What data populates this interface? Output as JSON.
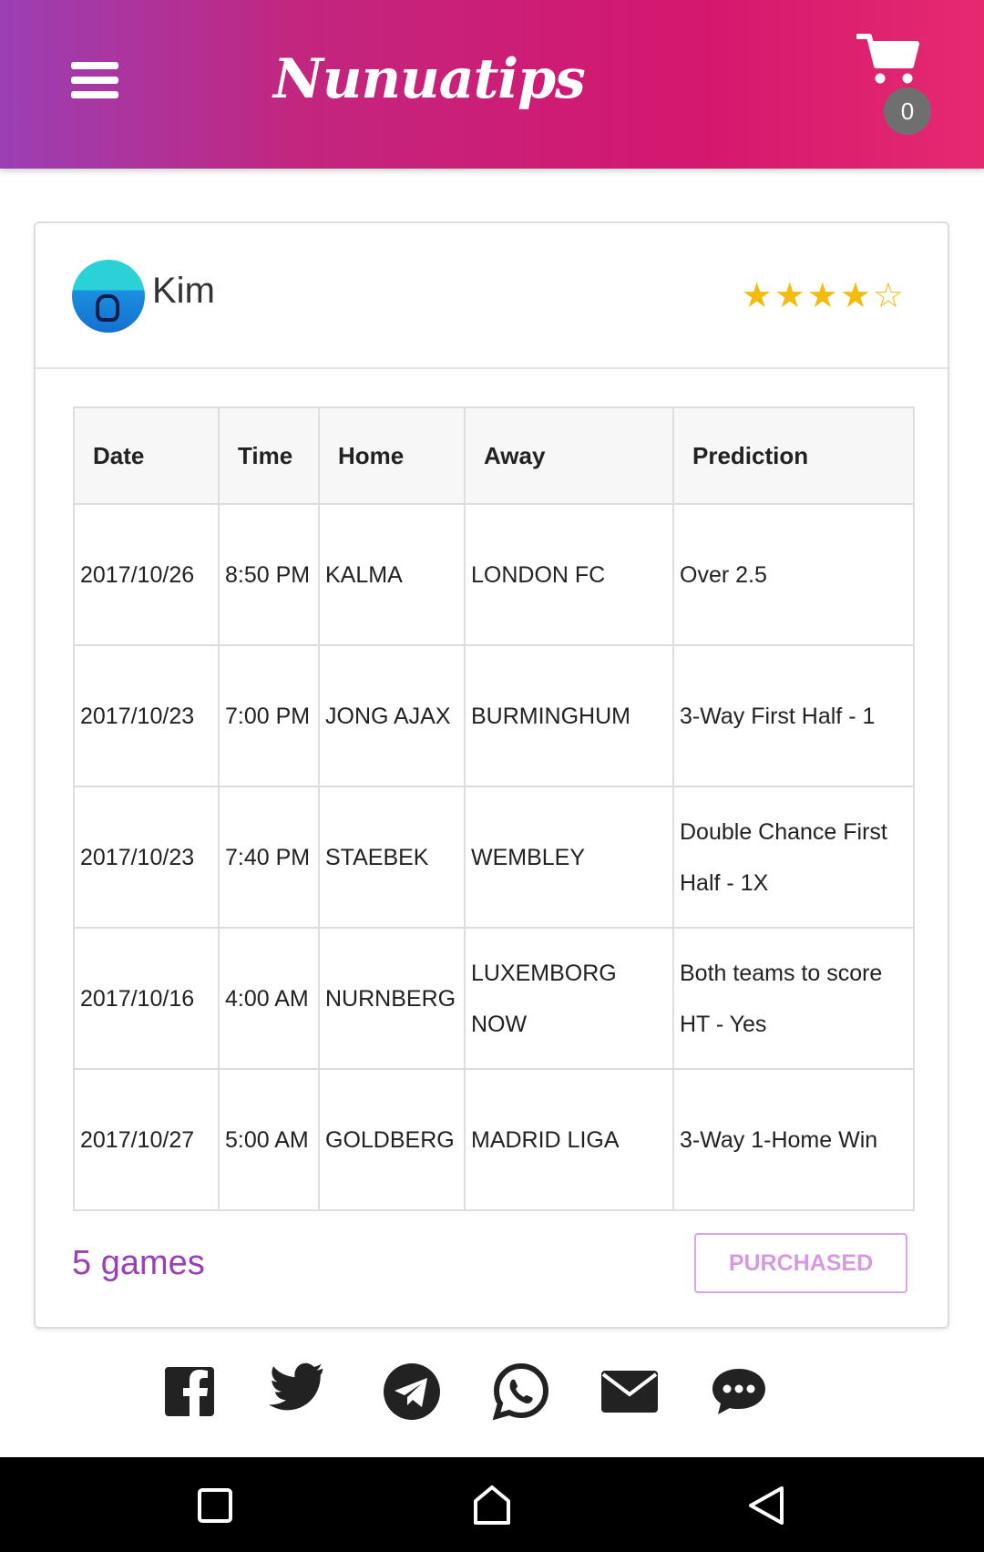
{
  "header": {
    "brand": "Nunuatips",
    "cart_count": "0",
    "menu_icon": "hamburger-menu-icon",
    "cart_icon": "shopping-cart-icon",
    "gradient_colors": [
      "#9b3fb5",
      "#d4176f",
      "#e6296f"
    ]
  },
  "tipster": {
    "name": "Kim",
    "rating": 4,
    "rating_max": 5,
    "stars": "★★★★☆",
    "star_color": "#f2bd0f"
  },
  "table": {
    "headers": [
      "Date",
      "Time",
      "Home",
      "Away",
      "Prediction"
    ],
    "rows": [
      {
        "date": "2017/10/26",
        "time": "8:50 PM",
        "home": "KALMA",
        "away": "LONDON FC",
        "prediction": "Over 2.5"
      },
      {
        "date": "2017/10/23",
        "time": "7:00 PM",
        "home": "JONG AJAX",
        "away": "BURMINGHUM",
        "prediction": "3-Way First Half - 1"
      },
      {
        "date": "2017/10/23",
        "time": "7:40 PM",
        "home": "STAEBEK",
        "away": "WEMBLEY",
        "prediction": "Double Chance First Half - 1X"
      },
      {
        "date": "2017/10/16",
        "time": "4:00 AM",
        "home": "NURNBERG",
        "away": "LUXEMBORG NOW",
        "prediction": "Both teams to score HT - Yes"
      },
      {
        "date": "2017/10/27",
        "time": "5:00 AM",
        "home": "GOLDBERG",
        "away": "MADRID LIGA",
        "prediction": "3-Way 1-Home Win"
      }
    ]
  },
  "footer": {
    "games_count": "5 games",
    "purchased_label": "PURCHASED",
    "accent_color": "#9b3fb5"
  },
  "share_icons": [
    "facebook-icon",
    "twitter-icon",
    "telegram-icon",
    "whatsapp-icon",
    "email-icon",
    "sms-chat-icon"
  ],
  "system_nav": [
    "recents-square-icon",
    "home-icon",
    "back-triangle-icon"
  ]
}
